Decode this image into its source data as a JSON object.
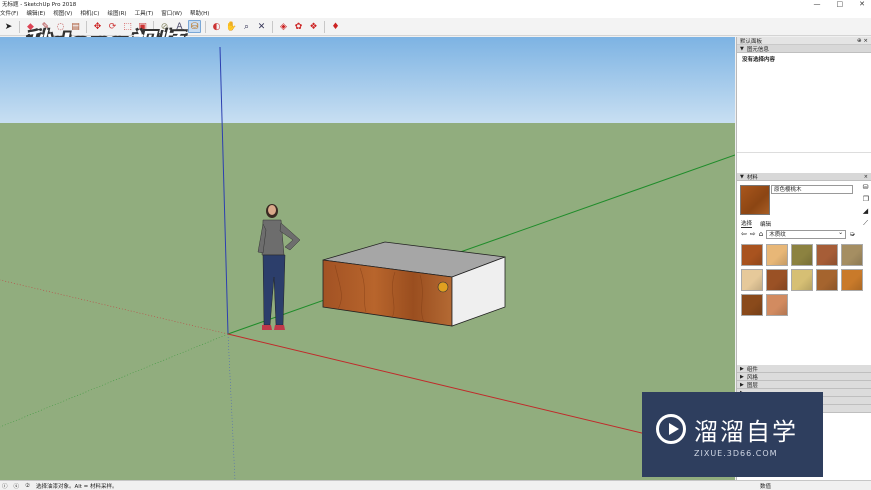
{
  "window": {
    "title": "无标题 - SketchUp Pro 2018",
    "controls": [
      "—",
      "□",
      "✕"
    ]
  },
  "menu": [
    "文件(F)",
    "编辑(E)",
    "视图(V)",
    "相机(C)",
    "绘图(R)",
    "工具(T)",
    "窗口(W)",
    "帮助(H)"
  ],
  "toolbar": {
    "icons": [
      "select-icon",
      "eraser-icon",
      "pencil-icon",
      "shape-icon",
      "push-pull-icon",
      "move-icon",
      "rotate-icon",
      "scale-icon",
      "offset-icon",
      "tape-measure-icon",
      "text-icon",
      "paint-bucket-icon",
      "orbit-icon",
      "pan-icon",
      "zoom-icon",
      "zoom-extents-icon",
      "warehouse-icon",
      "extension-icon",
      "layout-icon",
      "ruby-icon"
    ],
    "active": "paint-bucket-icon"
  },
  "overlay": {
    "brand_text": "秒dong视频"
  },
  "tray": {
    "title": "默认面板",
    "entity_info": {
      "header": "图元信息",
      "message": "没有选择内容"
    },
    "materials": {
      "header": "材料",
      "current_name": "原色樱桃木",
      "tab_select": "选择",
      "tab_edit": "编辑",
      "library": "木质纹",
      "swatches": [
        "#a9531f",
        "#e8b777",
        "#8c8240",
        "#a65d37",
        "#a58e62",
        "#e6c99a",
        "#9a5125",
        "#d6bf74",
        "#a5642e",
        "#c97a2a",
        "#8a4a1b",
        "#d28b60"
      ]
    },
    "collapsed": [
      "组件",
      "风格",
      "图层",
      "",
      "",
      ""
    ]
  },
  "status": {
    "hint": "选择油漆对象。Alt = 材料采样。",
    "measurements_label": "数值"
  },
  "watermark": {
    "title": "溜溜自学",
    "url": "ZIXUE.3D66.COM"
  }
}
